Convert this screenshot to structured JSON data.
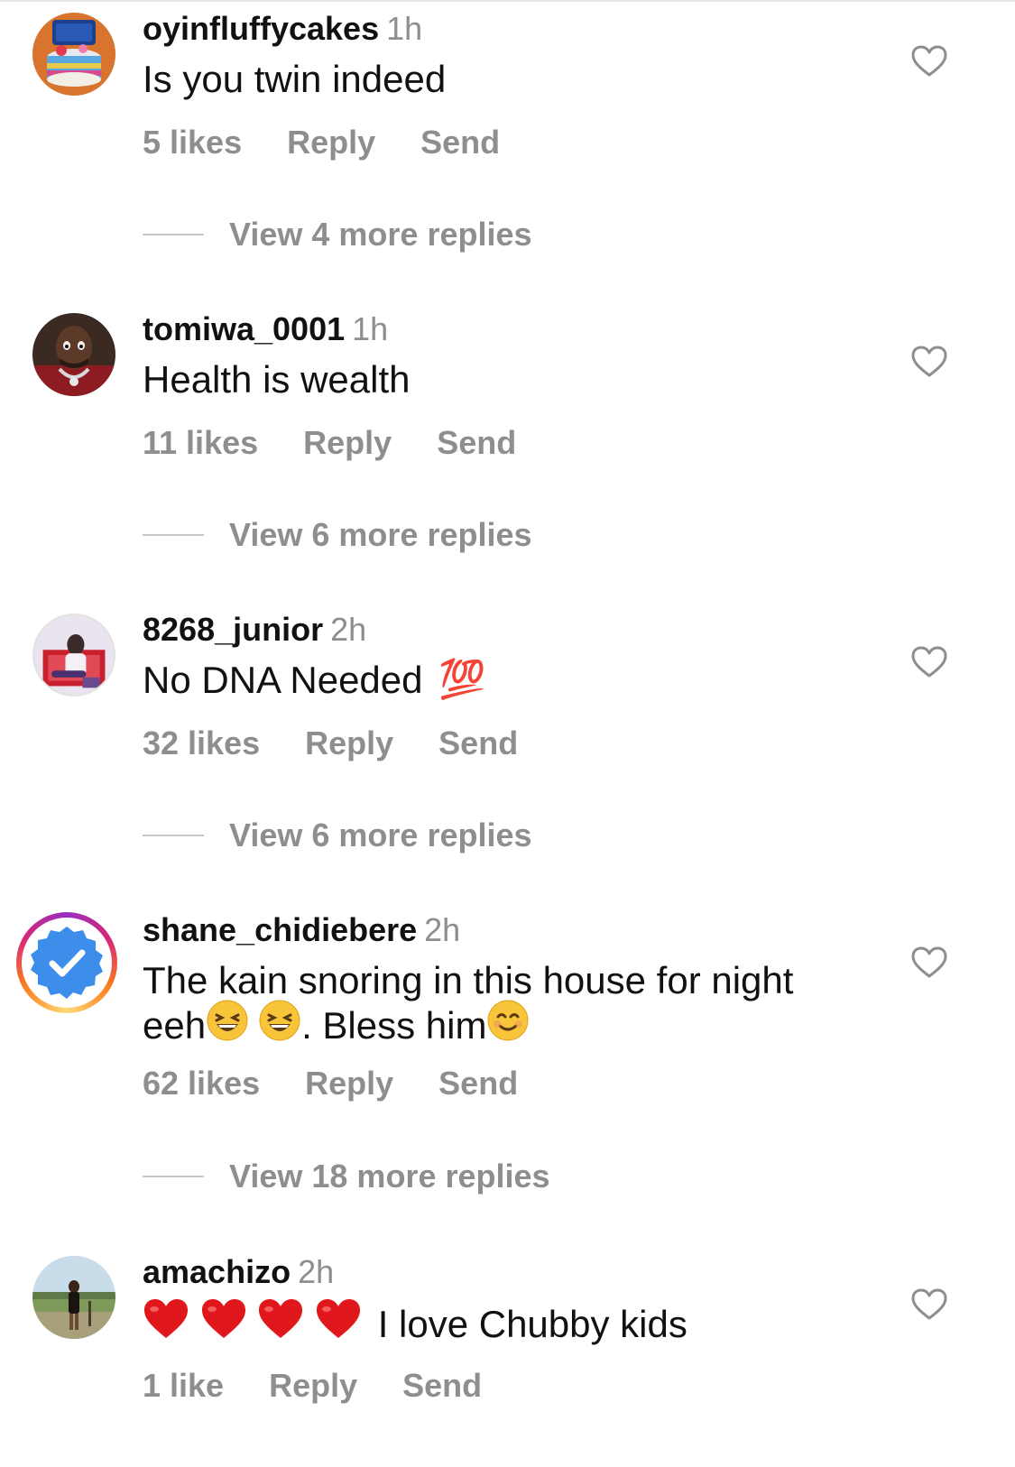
{
  "comments": [
    {
      "username": "oyinfluffycakes",
      "time": "1h",
      "text": "Is you twin indeed",
      "likes": "5 likes",
      "reply": "Reply",
      "send": "Send",
      "view_replies": "View 4 more replies"
    },
    {
      "username": "tomiwa_0001",
      "time": "1h",
      "text": "Health is wealth",
      "likes": "11 likes",
      "reply": "Reply",
      "send": "Send",
      "view_replies": "View 6 more replies"
    },
    {
      "username": "8268_junior",
      "time": "2h",
      "text": "No DNA Needed",
      "emoji_after": "💯",
      "likes": "32 likes",
      "reply": "Reply",
      "send": "Send",
      "view_replies": "View 6 more replies"
    },
    {
      "username": "shane_chidiebere",
      "time": "2h",
      "text_line1": "The kain snoring in this house for night",
      "text_part_a": "eeh",
      "text_part_b": ". Bless him",
      "likes": "62 likes",
      "reply": "Reply",
      "send": "Send",
      "view_replies": "View 18 more replies"
    },
    {
      "username": "amachizo",
      "time": "2h",
      "text": "I love Chubby kids",
      "likes": "1 like",
      "reply": "Reply",
      "send": "Send"
    }
  ],
  "icons": {
    "like": "heart-outline-icon",
    "verified": "verified-check-icon"
  },
  "colors": {
    "secondary_text": "#8e8e8e",
    "primary_text": "#111111",
    "verified_blue": "#3d8eea"
  }
}
